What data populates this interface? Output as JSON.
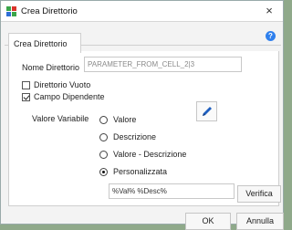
{
  "window": {
    "title": "Crea Direttorio",
    "close_glyph": "×"
  },
  "tabs": [
    {
      "label": "Crea Direttorio",
      "active": true
    }
  ],
  "help_glyph": "?",
  "form": {
    "nome_label": "Nome Direttorio",
    "nome_value": "PARAMETER_FROM_CELL_2|3",
    "direttorio_vuoto_label": "Direttorio Vuoto",
    "direttorio_vuoto_checked": false,
    "campo_dipendente_label": "Campo Dipendente",
    "campo_dipendente_checked": true,
    "valore_variabile_label": "Valore Variabile",
    "radio_options": [
      {
        "label": "Valore",
        "selected": false
      },
      {
        "label": "Descrizione",
        "selected": false
      },
      {
        "label": "Valore - Descrizione",
        "selected": false
      },
      {
        "label": "Personalizzata",
        "selected": true
      }
    ],
    "custom_value": "%Val% %Desc%",
    "verifica_label": "Verifica"
  },
  "footer": {
    "ok_label": "OK",
    "cancel_label": "Annulla"
  },
  "icons": {
    "app": "app-icon",
    "edit": "pencil-icon",
    "help": "help-icon",
    "close": "close-icon"
  },
  "colors": {
    "accent": "#2f80ed",
    "pencil": "#1f5fbf",
    "app_icon_green": "#3aa54a",
    "app_icon_red": "#d9342b",
    "app_icon_blue": "#2f6fd6"
  }
}
